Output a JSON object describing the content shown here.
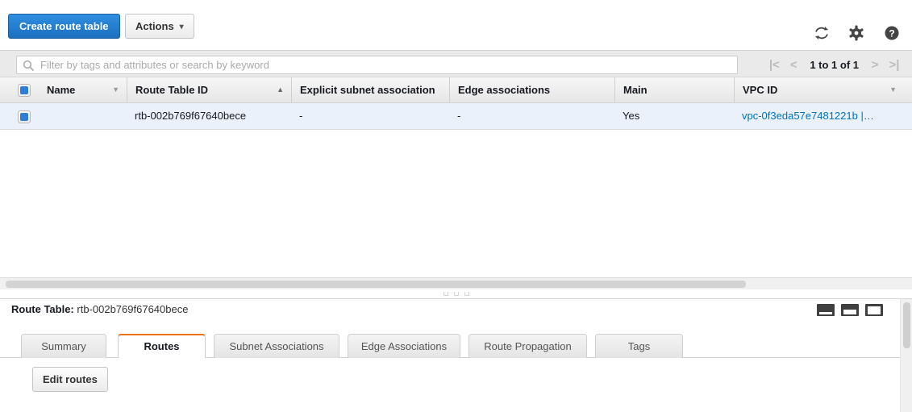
{
  "toolbar": {
    "create_label": "Create route table",
    "actions_label": "Actions",
    "refresh_icon": "refresh-icon",
    "settings_icon": "gear-icon",
    "help_icon": "help-icon"
  },
  "filter": {
    "placeholder": "Filter by tags and attributes or search by keyword",
    "value": "",
    "search_icon": "search-icon"
  },
  "pagination": {
    "first_label": "|<",
    "prev_label": "<",
    "range_label": "1 to 1 of 1",
    "next_label": ">",
    "last_label": ">|"
  },
  "table": {
    "columns": [
      {
        "label": "Name",
        "sort": "menu"
      },
      {
        "label": "Route Table ID",
        "sort": "asc"
      },
      {
        "label": "Explicit subnet association",
        "sort": "none"
      },
      {
        "label": "Edge associations",
        "sort": "none"
      },
      {
        "label": "Main",
        "sort": "none"
      },
      {
        "label": "VPC ID",
        "sort": "menu"
      }
    ],
    "rows": [
      {
        "name": "",
        "route_table_id": "rtb-002b769f67640bece",
        "explicit_subnet_association": "-",
        "edge_associations": "-",
        "main": "Yes",
        "vpc_id": "vpc-0f3eda57e7481221b |…"
      }
    ]
  },
  "detail": {
    "title_label": "Route Table:",
    "title_value": "rtb-002b769f67640bece",
    "panel_icons": [
      "layout-bottom-icon",
      "layout-half-icon",
      "layout-top-icon"
    ],
    "tabs": [
      {
        "label": "Summary",
        "active": false
      },
      {
        "label": "Routes",
        "active": true
      },
      {
        "label": "Subnet Associations",
        "active": false
      },
      {
        "label": "Edge Associations",
        "active": false
      },
      {
        "label": "Route Propagation",
        "active": false
      },
      {
        "label": "Tags",
        "active": false
      }
    ],
    "edit_routes_label": "Edit routes"
  },
  "colors": {
    "accent_blue": "#1c6fbf",
    "link_blue": "#0073bb",
    "active_tab_orange": "#ec7211",
    "selected_row": "#eaf1fb"
  }
}
